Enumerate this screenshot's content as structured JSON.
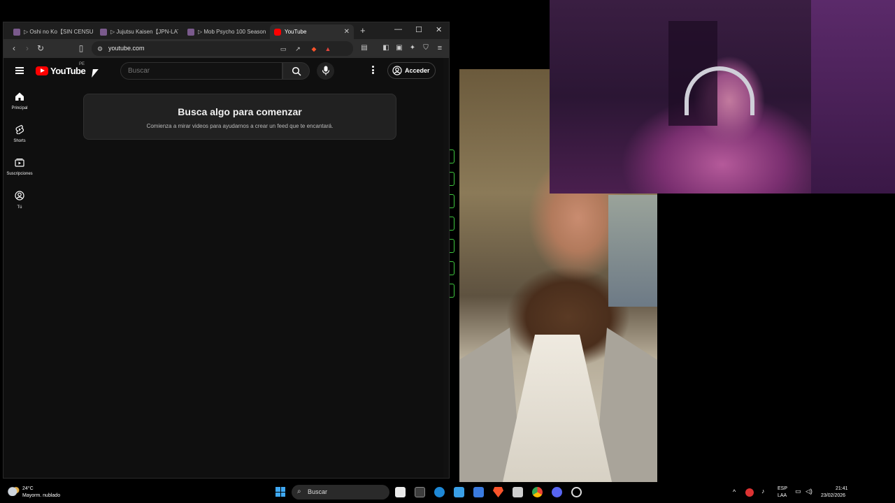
{
  "browser": {
    "tabs": [
      {
        "title": "▷ Oshi no Ko【SIN CENSU",
        "active": false
      },
      {
        "title": "▷ Jujutsu Kaisen【JPN-LAT",
        "active": false
      },
      {
        "title": "▷ Mob Psycho 100 Season",
        "active": false
      },
      {
        "title": "YouTube",
        "active": true
      }
    ],
    "new_tab_icon": "+",
    "minimize_icon": "—",
    "maximize_icon": "☐",
    "close_icon": "✕",
    "url": "youtube.com"
  },
  "youtube": {
    "logo_text": "YouTube",
    "country_code": "PE",
    "search_placeholder": "Buscar",
    "signin_label": "Acceder",
    "sidebar": [
      {
        "label": "Principal",
        "icon": "home-icon"
      },
      {
        "label": "Shorts",
        "icon": "shorts-icon"
      },
      {
        "label": "Suscripciones",
        "icon": "subscriptions-icon"
      },
      {
        "label": "Tú",
        "icon": "you-icon"
      }
    ],
    "prompt_title": "Busca algo para comenzar",
    "prompt_subtitle": "Comienza a mirar videos para ayudarnos a crear un feed que te encantará."
  },
  "taskbar": {
    "temperature": "24°C",
    "weather": "Mayorm. nublado",
    "search_label": "Buscar",
    "language_line1": "ESP",
    "language_line2": "LAA",
    "time": "21:41",
    "date": "23/02/2026"
  },
  "colors": {
    "yt_red": "#ff0000",
    "page_bg": "#0f0f0f",
    "green_ticks": "#3ec73e"
  }
}
